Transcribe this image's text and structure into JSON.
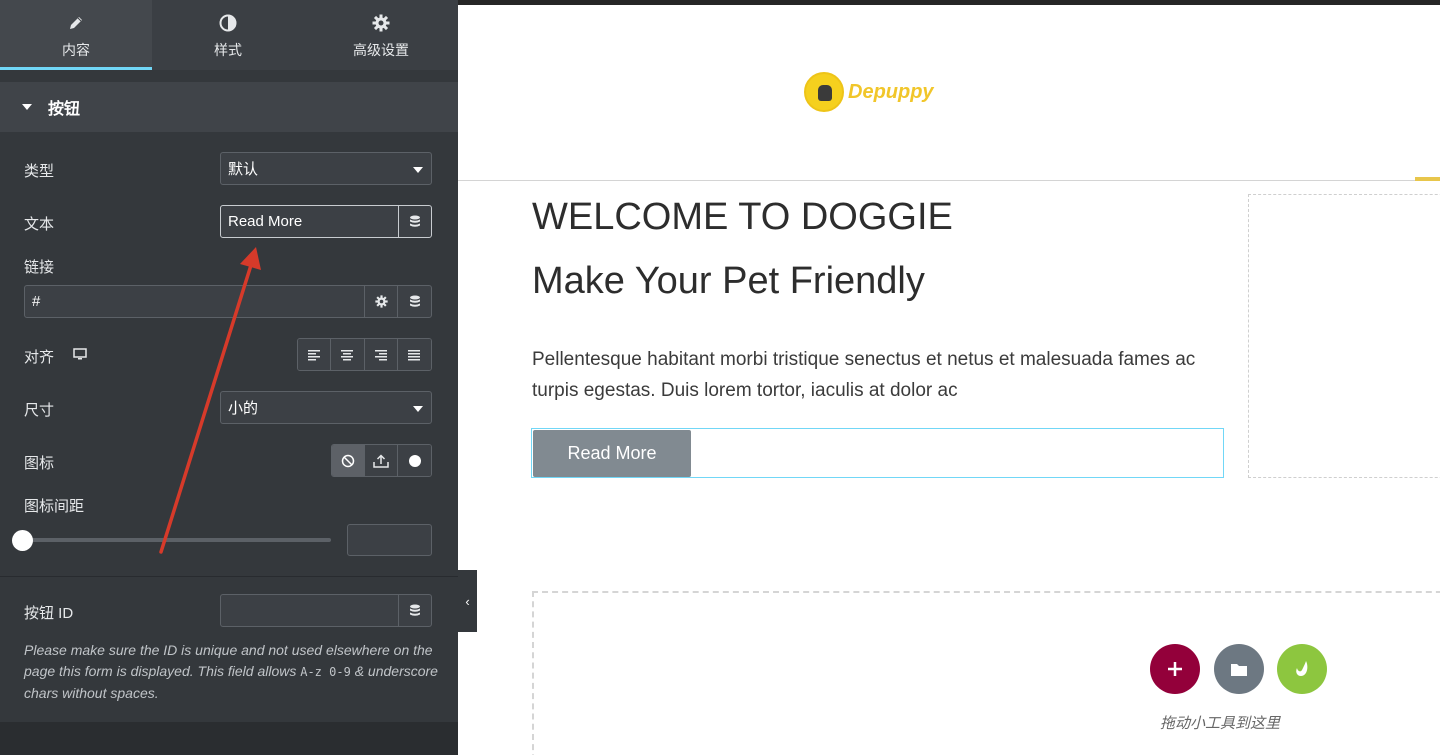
{
  "tabs": [
    {
      "label": "内容",
      "icon": "pencil-icon",
      "active": true
    },
    {
      "label": "样式",
      "icon": "half-circle-icon",
      "active": false
    },
    {
      "label": "高级设置",
      "icon": "gear-icon",
      "active": false
    }
  ],
  "section": {
    "title": "按钮"
  },
  "fields": {
    "type": {
      "label": "类型",
      "value": "默认"
    },
    "text": {
      "label": "文本",
      "value": "Read More"
    },
    "link": {
      "label": "链接",
      "value": "#"
    },
    "align": {
      "label": "对齐"
    },
    "size": {
      "label": "尺寸",
      "value": "小的"
    },
    "icon": {
      "label": "图标"
    },
    "icon_spacing": {
      "label": "图标间距",
      "value": ""
    },
    "button_id": {
      "label": "按钮 ID",
      "value": ""
    }
  },
  "note": {
    "part1": "Please make sure the ID is unique and not used elsewhere on the page this form is displayed. This field allows ",
    "code": "A-z 0-9",
    "part2": " & underscore chars without spaces."
  },
  "canvas": {
    "logo_text": "Depuppy",
    "heading1": "WELCOME TO DOGGIE",
    "heading2": "Make Your Pet Friendly",
    "paragraph": "Pellentesque habitant morbi tristique senectus et netus et malesuada fames ac turpis egestas. Duis lorem tortor, iaculis at dolor ac",
    "button_label": "Read More",
    "drop_text": "拖动小工具到这里"
  },
  "colors": {
    "accent": "#71d7f7",
    "add": "#93003a",
    "folder": "#6d7882",
    "leaf": "#8dc63f",
    "arrow": "#d63a2a"
  }
}
